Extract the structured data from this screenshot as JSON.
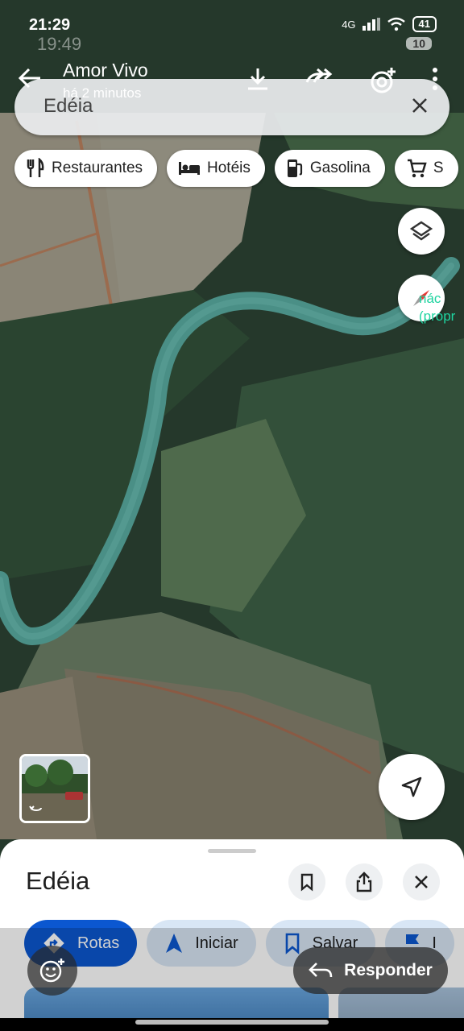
{
  "status_bar": {
    "time": "21:29",
    "ghost_time": "19:49",
    "network": "4G",
    "battery": "41",
    "ghost_battery": "10",
    "more": "···"
  },
  "chat_header": {
    "title": "Amor Vivo",
    "subtitle": "há 2 minutos"
  },
  "search": {
    "query": "Edéia"
  },
  "chips": [
    "Restaurantes",
    "Hotéis",
    "Gasolina",
    "S"
  ],
  "map": {
    "label_line1": "nác",
    "label_line2": "(propr"
  },
  "place": {
    "title": "Edéia"
  },
  "actions": [
    "Rotas",
    "Iniciar",
    "Salvar",
    "I"
  ],
  "reply": {
    "label": "Responder"
  },
  "colors": {
    "accent": "#0b57d0",
    "river": "#4a8f86",
    "label": "#1fd4a0"
  }
}
